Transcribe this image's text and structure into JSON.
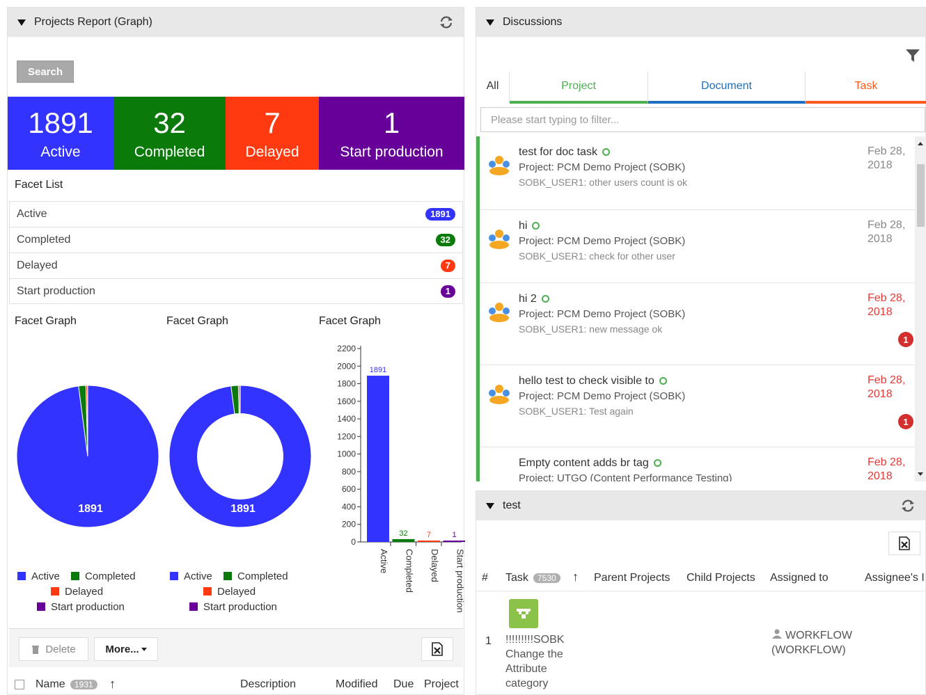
{
  "left_panel": {
    "title": "Projects Report (Graph)",
    "search_label": "Search",
    "tiles": [
      {
        "num": "1891",
        "label": "Active",
        "color": "#3333ff"
      },
      {
        "num": "32",
        "label": "Completed",
        "color": "#0a7a0a"
      },
      {
        "num": "7",
        "label": "Delayed",
        "color": "#ff3a10"
      },
      {
        "num": "1",
        "label": "Start production",
        "color": "#660099"
      }
    ],
    "facet_list_title": "Facet List",
    "facets": [
      {
        "label": "Active",
        "count": "1891",
        "color": "#3333ff"
      },
      {
        "label": "Completed",
        "count": "32",
        "color": "#0a7a0a"
      },
      {
        "label": "Delayed",
        "count": "7",
        "color": "#ff3a10"
      },
      {
        "label": "Start production",
        "count": "1",
        "color": "#660099"
      }
    ],
    "facet_graph_titles": [
      "Facet Graph",
      "Facet Graph",
      "Facet Graph"
    ],
    "legend": [
      {
        "label": "Active",
        "color": "#3333ff"
      },
      {
        "label": "Completed",
        "color": "#0a7a0a"
      },
      {
        "label": "Delayed",
        "color": "#ff3a10"
      },
      {
        "label": "Start production",
        "color": "#660099"
      }
    ],
    "delete_label": "Delete",
    "more_label": "More...",
    "grid_columns": {
      "name": "Name",
      "count": "1931",
      "description": "Description",
      "modified": "Modified",
      "due": "Due",
      "project": "Project"
    }
  },
  "chart_data": [
    {
      "type": "pie",
      "title": "Facet Graph",
      "categories": [
        "Active",
        "Completed",
        "Delayed",
        "Start production"
      ],
      "values": [
        1891,
        32,
        7,
        1
      ],
      "colors": [
        "#3333ff",
        "#0a7a0a",
        "#ff3a10",
        "#660099"
      ],
      "label": "1891",
      "legend": "bottom"
    },
    {
      "type": "pie",
      "title": "Facet Graph",
      "donut": true,
      "categories": [
        "Active",
        "Completed",
        "Delayed",
        "Start production"
      ],
      "values": [
        1891,
        32,
        7,
        1
      ],
      "colors": [
        "#3333ff",
        "#0a7a0a",
        "#ff3a10",
        "#660099"
      ],
      "label": "1891",
      "legend": "bottom"
    },
    {
      "type": "bar",
      "title": "Facet Graph",
      "categories": [
        "Active",
        "Completed",
        "Delayed",
        "Start production"
      ],
      "values": [
        1891,
        32,
        7,
        1
      ],
      "colors": [
        "#3333ff",
        "#0a7a0a",
        "#ff3a10",
        "#660099"
      ],
      "ylim": [
        0,
        2200
      ],
      "yticks": [
        "0",
        "200",
        "400",
        "600",
        "800",
        "1000",
        "1200",
        "1400",
        "1600",
        "1800",
        "2000",
        "2200"
      ]
    }
  ],
  "discussions": {
    "title": "Discussions",
    "tabs": [
      {
        "label": "All",
        "color": "#333333"
      },
      {
        "label": "Project",
        "color": "#4caf50"
      },
      {
        "label": "Document",
        "color": "#1e6fbf"
      },
      {
        "label": "Task",
        "color": "#ff5a1f"
      }
    ],
    "filter_placeholder": "Please start typing to filter...",
    "items": [
      {
        "title": "test for doc task",
        "project": "Project: PCM Demo Project (SOBK)",
        "msg": "SOBK_USER1: other users count is ok",
        "date": "Feb 28, 2018",
        "date_color": "#888888",
        "notif": ""
      },
      {
        "title": "hi",
        "project": "Project: PCM Demo Project (SOBK)",
        "msg": "SOBK_USER1: check for other user",
        "date": "Feb 28, 2018",
        "date_color": "#888888",
        "notif": ""
      },
      {
        "title": "hi 2",
        "project": "Project: PCM Demo Project (SOBK)",
        "msg": "SOBK_USER1: new message ok",
        "date": "Feb 28, 2018",
        "date_color": "#e53935",
        "notif": "1"
      },
      {
        "title": "hello test to check visible to",
        "project": "Project: PCM Demo Project (SOBK)",
        "msg": "SOBK_USER1: Test again",
        "date": "Feb 28, 2018",
        "date_color": "#e53935",
        "notif": "1"
      },
      {
        "title": "Empty content adds br tag",
        "project": "Project: UTGO (Content Performance Testing)",
        "msg": "",
        "date": "Feb 28, 2018",
        "date_color": "#e53935",
        "notif": ""
      }
    ]
  },
  "test_panel": {
    "title": "test",
    "columns": {
      "hash": "#",
      "task": "Task",
      "task_count": "7530",
      "parent": "Parent Projects",
      "child": "Child Projects",
      "assigned": "Assigned to",
      "assignee": "Assignee's I"
    },
    "row": {
      "num": "1",
      "task_lines": [
        "!!!!!!!!!SOBK",
        "Change the",
        "Attribute",
        "category"
      ],
      "assigned_lines": [
        "WORKFLOW",
        "(WORKFLOW)"
      ]
    }
  }
}
